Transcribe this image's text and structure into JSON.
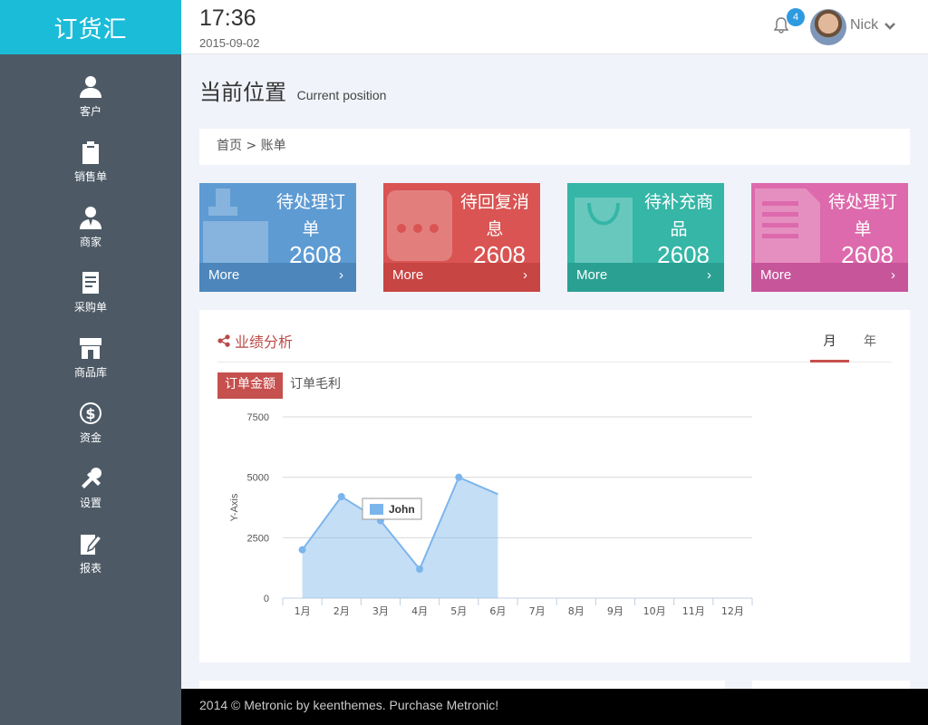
{
  "brand": {
    "name": "订货汇"
  },
  "sidebar": {
    "items": [
      {
        "label": "客户",
        "icon": "user-icon"
      },
      {
        "label": "销售单",
        "icon": "clipboard-icon"
      },
      {
        "label": "商家",
        "icon": "merchant-icon"
      },
      {
        "label": "采购单",
        "icon": "document-icon"
      },
      {
        "label": "商品库",
        "icon": "store-icon"
      },
      {
        "label": "资金",
        "icon": "dollar-icon"
      },
      {
        "label": "设置",
        "icon": "tools-icon"
      },
      {
        "label": "报表",
        "icon": "edit-report-icon"
      }
    ]
  },
  "header": {
    "time": "17:36",
    "date": "2015-09-02",
    "notification_count": "4",
    "username": "Nick"
  },
  "page": {
    "title": "当前位置",
    "subtitle": "Current position"
  },
  "breadcrumb": {
    "text": "首页 > 账单"
  },
  "stats": [
    {
      "label": "待处理订单",
      "value": "2608",
      "more": "More",
      "color": "#5e9bd3",
      "icon": "handbag-icon"
    },
    {
      "label": "待回复消息",
      "value": "2608",
      "more": "More",
      "color": "#d95452",
      "icon": "chat-icon"
    },
    {
      "label": "待补充商品",
      "value": "2608",
      "more": "More",
      "color": "#35b6a7",
      "icon": "shopping-bag-icon"
    },
    {
      "label": "待处理订单",
      "value": "2608",
      "more": "More",
      "color": "#dd6aac",
      "icon": "file-icon"
    }
  ],
  "portlet": {
    "title": "业绩分析",
    "tabs": [
      "月",
      "年"
    ],
    "active_tab": "月",
    "subtabs": [
      "订单金额",
      "订单毛利"
    ],
    "active_subtab": "订单金额"
  },
  "chart_data": {
    "type": "area",
    "categories": [
      "1月",
      "2月",
      "3月",
      "4月",
      "5月",
      "6月",
      "7月",
      "8月",
      "9月",
      "10月",
      "11月",
      "12月"
    ],
    "series": [
      {
        "name": "John",
        "values": [
          2000,
          4200,
          3200,
          1200,
          5000,
          4300,
          null,
          null,
          null,
          null,
          null,
          null
        ],
        "color": "#7cb5ec"
      }
    ],
    "ylabel": "Y-Axis",
    "yticks": [
      0,
      2500,
      5000,
      7500
    ],
    "ylim": [
      0,
      7500
    ],
    "grid": true,
    "legend": "inside-center"
  },
  "footer": {
    "text": "2014 © Metronic by keenthemes. Purchase Metronic!"
  }
}
